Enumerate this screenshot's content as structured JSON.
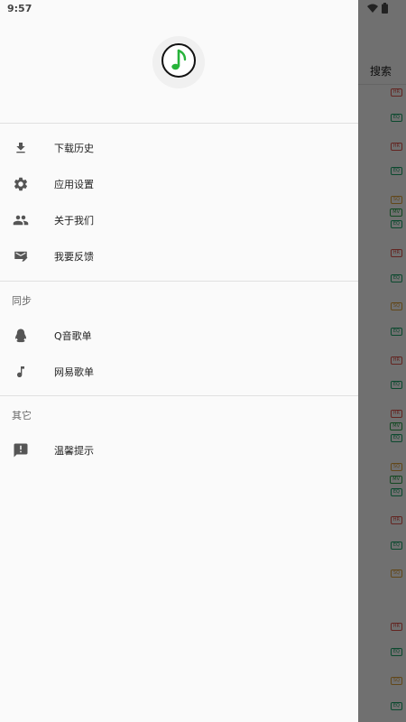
{
  "status_bar": {
    "time": "9:57"
  },
  "app": {
    "search_label": "搜索",
    "badges": [
      {
        "text": "HR",
        "kind": "hr"
      },
      {
        "text": "EQ",
        "kind": "eq"
      },
      {
        "text": "HR",
        "kind": "hr"
      },
      {
        "text": "EQ",
        "kind": "eq"
      },
      {
        "text": "SQ",
        "kind": "sq"
      },
      {
        "text": "MV",
        "kind": "mv"
      },
      {
        "text": "EQ",
        "kind": "eq"
      },
      {
        "text": "HR",
        "kind": "hr"
      },
      {
        "text": "EQ",
        "kind": "eq"
      },
      {
        "text": "SQ",
        "kind": "sq"
      },
      {
        "text": "EQ",
        "kind": "eq"
      },
      {
        "text": "HR",
        "kind": "hr"
      },
      {
        "text": "EQ",
        "kind": "eq"
      },
      {
        "text": "HR",
        "kind": "hr"
      },
      {
        "text": "MV",
        "kind": "mv"
      },
      {
        "text": "EQ",
        "kind": "eq"
      },
      {
        "text": "SQ",
        "kind": "sq"
      },
      {
        "text": "MV",
        "kind": "mv"
      },
      {
        "text": "EQ",
        "kind": "eq"
      },
      {
        "text": "HR",
        "kind": "hr"
      },
      {
        "text": "EQ",
        "kind": "eq"
      },
      {
        "text": "SQ",
        "kind": "sq"
      },
      {
        "text": "HR",
        "kind": "hr"
      },
      {
        "text": "EQ",
        "kind": "eq"
      },
      {
        "text": "SQ",
        "kind": "sq"
      },
      {
        "text": "EQ",
        "kind": "eq"
      }
    ]
  },
  "drawer": {
    "logo_icon": "music-note-icon",
    "menu": [
      {
        "label": "下载历史",
        "icon": "download-icon"
      },
      {
        "label": "应用设置",
        "icon": "gear-icon"
      },
      {
        "label": "关于我们",
        "icon": "people-icon"
      },
      {
        "label": "我要反馈",
        "icon": "feedback-icon"
      }
    ],
    "sync_section": {
      "title": "同步",
      "items": [
        {
          "label": "Q音歌单",
          "icon": "qq-penguin-icon"
        },
        {
          "label": "网易歌单",
          "icon": "music-note-icon"
        }
      ]
    },
    "other_section": {
      "title": "其它",
      "items": [
        {
          "label": "温馨提示",
          "icon": "announcement-icon"
        }
      ]
    }
  }
}
